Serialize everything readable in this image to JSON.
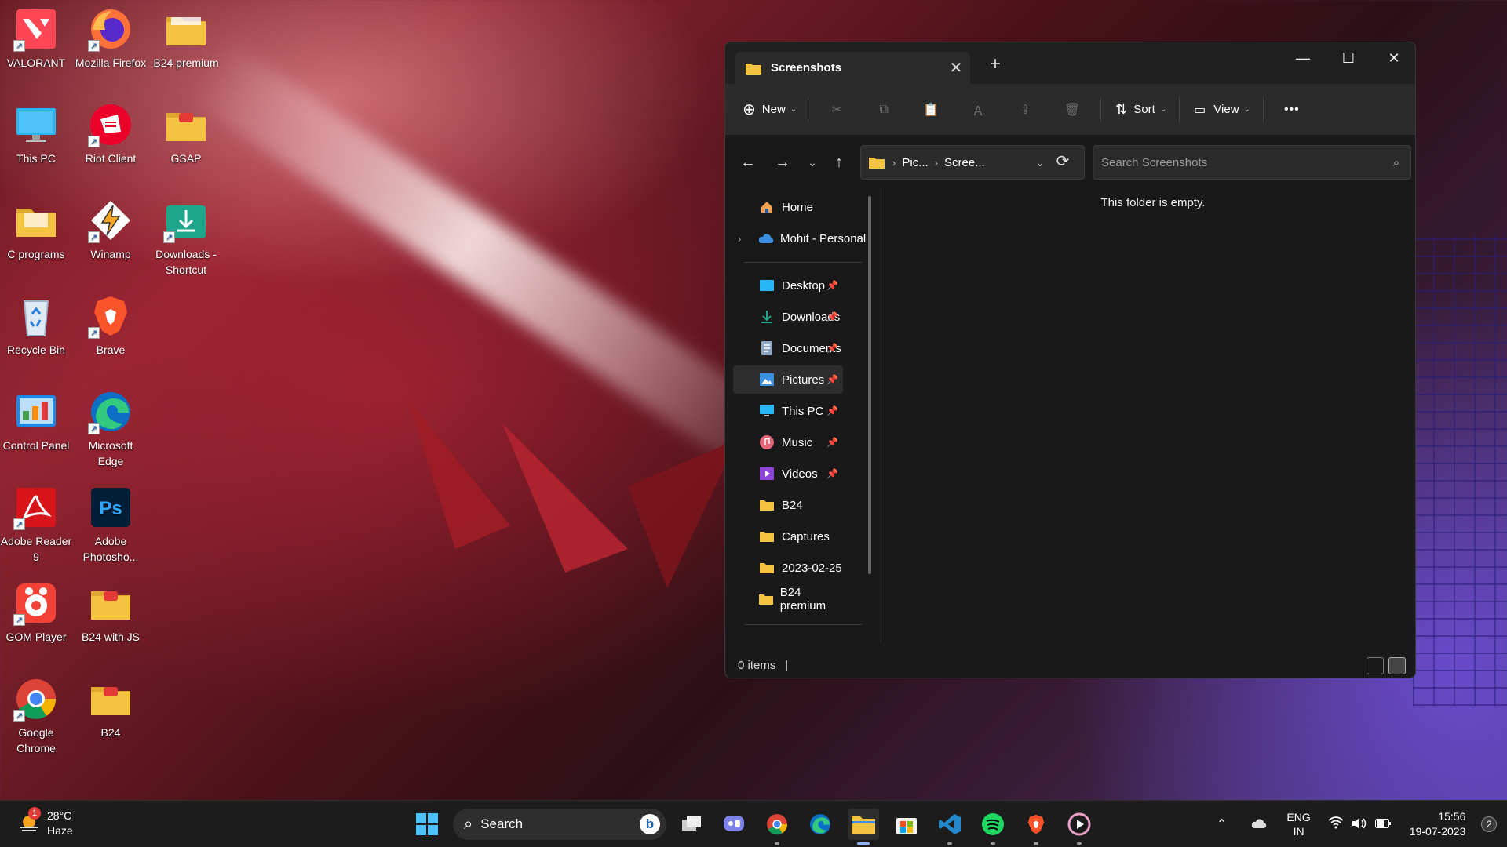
{
  "desktop": {
    "icons": [
      {
        "label": "VALORANT",
        "icon": "valorant-icon"
      },
      {
        "label": "Mozilla Firefox",
        "icon": "firefox-icon"
      },
      {
        "label": "B24 premium",
        "icon": "folder-icon"
      },
      {
        "label": "This PC",
        "icon": "monitor-icon"
      },
      {
        "label": "Riot Client",
        "icon": "riot-icon"
      },
      {
        "label": "GSAP",
        "icon": "folder-icon"
      },
      {
        "label": "C programs",
        "icon": "folder-icon"
      },
      {
        "label": "Winamp",
        "icon": "winamp-icon"
      },
      {
        "label": "Downloads - Shortcut",
        "icon": "download-folder-icon"
      },
      {
        "label": "Recycle Bin",
        "icon": "recycle-bin-icon"
      },
      {
        "label": "Brave",
        "icon": "brave-icon"
      },
      {
        "label": "Control Panel",
        "icon": "control-panel-icon"
      },
      {
        "label": "Microsoft Edge",
        "icon": "edge-icon"
      },
      {
        "label": "Adobe Reader 9",
        "icon": "adobe-reader-icon"
      },
      {
        "label": "Adobe Photosho...",
        "icon": "photoshop-icon"
      },
      {
        "label": "GOM Player",
        "icon": "gom-player-icon"
      },
      {
        "label": "B24 with JS",
        "icon": "folder-icon"
      },
      {
        "label": "Google Chrome",
        "icon": "chrome-icon"
      },
      {
        "label": "B24",
        "icon": "folder-icon"
      }
    ]
  },
  "explorer": {
    "tab_title": "Screenshots",
    "toolbar": {
      "new_label": "New",
      "sort_label": "Sort",
      "view_label": "View",
      "more_label": "•••"
    },
    "breadcrumb": [
      "Pic...",
      "Scree..."
    ],
    "search_placeholder": "Search Screenshots",
    "nav": {
      "home": "Home",
      "onedrive": "Mohit - Personal",
      "quick_access": [
        {
          "label": "Desktop",
          "icon": "desktop-icon"
        },
        {
          "label": "Downloads",
          "icon": "downloads-icon"
        },
        {
          "label": "Documents",
          "icon": "documents-icon"
        },
        {
          "label": "Pictures",
          "icon": "pictures-icon"
        },
        {
          "label": "This PC",
          "icon": "this-pc-icon"
        },
        {
          "label": "Music",
          "icon": "music-icon"
        },
        {
          "label": "Videos",
          "icon": "videos-icon"
        }
      ],
      "folders": [
        "B24",
        "Captures",
        "2023-02-25",
        "B24 premium"
      ]
    },
    "empty_message": "This folder is empty.",
    "status": "0 items"
  },
  "taskbar": {
    "weather_temp": "28°C",
    "weather_desc": "Haze",
    "weather_badge": "1",
    "search_label": "Search",
    "lang_top": "ENG",
    "lang_bottom": "IN",
    "time": "15:56",
    "date": "19-07-2023",
    "notification_count": "2"
  },
  "colors": {
    "accent": "#4cc2ff",
    "folder": "#f5c342",
    "explorer_bg": "#191919",
    "toolbar_bg": "#2b2b2b"
  }
}
